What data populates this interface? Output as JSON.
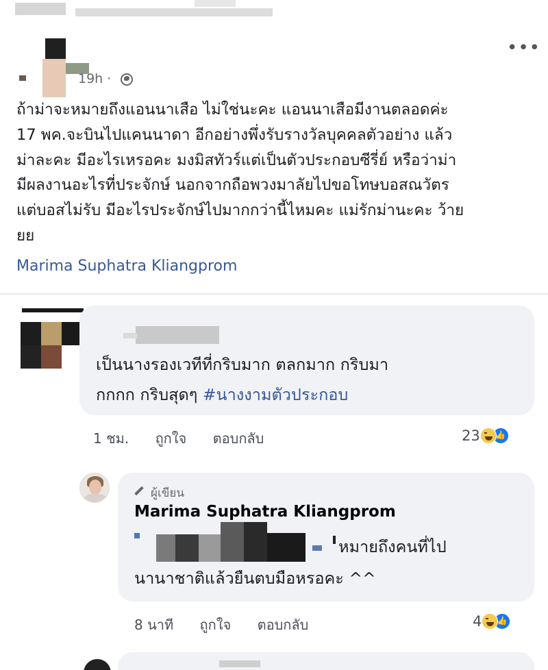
{
  "post": {
    "time": "19h ·",
    "more_label": "•••",
    "body_lines": [
      "ถ้าม่าจะหมายถึงแอนนาเสือ ไม่ใช่นะคะ แอนนาเสือมีงานตลอดค่ะ",
      "17 พค.จะบินไปแคนนาดา อีกอย่างพึ่งรับรางวัลบุคคลตัวอย่าง แล้ว",
      "ม่าละคะ มีอะไรเหรอคะ มงมิสทัวร์แต่เป็นตัวประกอบซีรี่ย์ หรือว่าม่า",
      "มีผลงานอะไรที่ประจักษ์ นอกจากถือพวงมาลัยไปขอโทษบอสณวัตร",
      "แต่บอสไม่รับ มีอะไรประจักษ์ไปมากกว่านี้ไหมคะ แม่รักม่านะคะ ว้าย",
      "ยย"
    ],
    "tag": "Marima Suphatra Kliangprom"
  },
  "comment1": {
    "text_line1": "เป็นนางรองเวทีที่กริบมาก ตลกมาก กริบมา",
    "text_line2_prefix": "กกกก กริบสุดๆ ",
    "hashtag": "#นางงามตัวประกอบ",
    "time": "1 ชม.",
    "like_label": "ถูกใจ",
    "reply_label": "ตอบกลับ",
    "reaction_count": "23"
  },
  "reply": {
    "author_label": "ผู้เขียน",
    "name": "Marima Suphatra Kliangprom",
    "text_line1": "หมายถึงคนที่ไป",
    "text_line2": "นานาชาติแล้วยืนตบมือหรอคะ ^^",
    "time": "8 นาที",
    "like_label": "ถูกใจ",
    "reply_label": "ตอบกลับ",
    "reaction_count": "4"
  },
  "icons": {
    "reaction_like": "👍"
  }
}
